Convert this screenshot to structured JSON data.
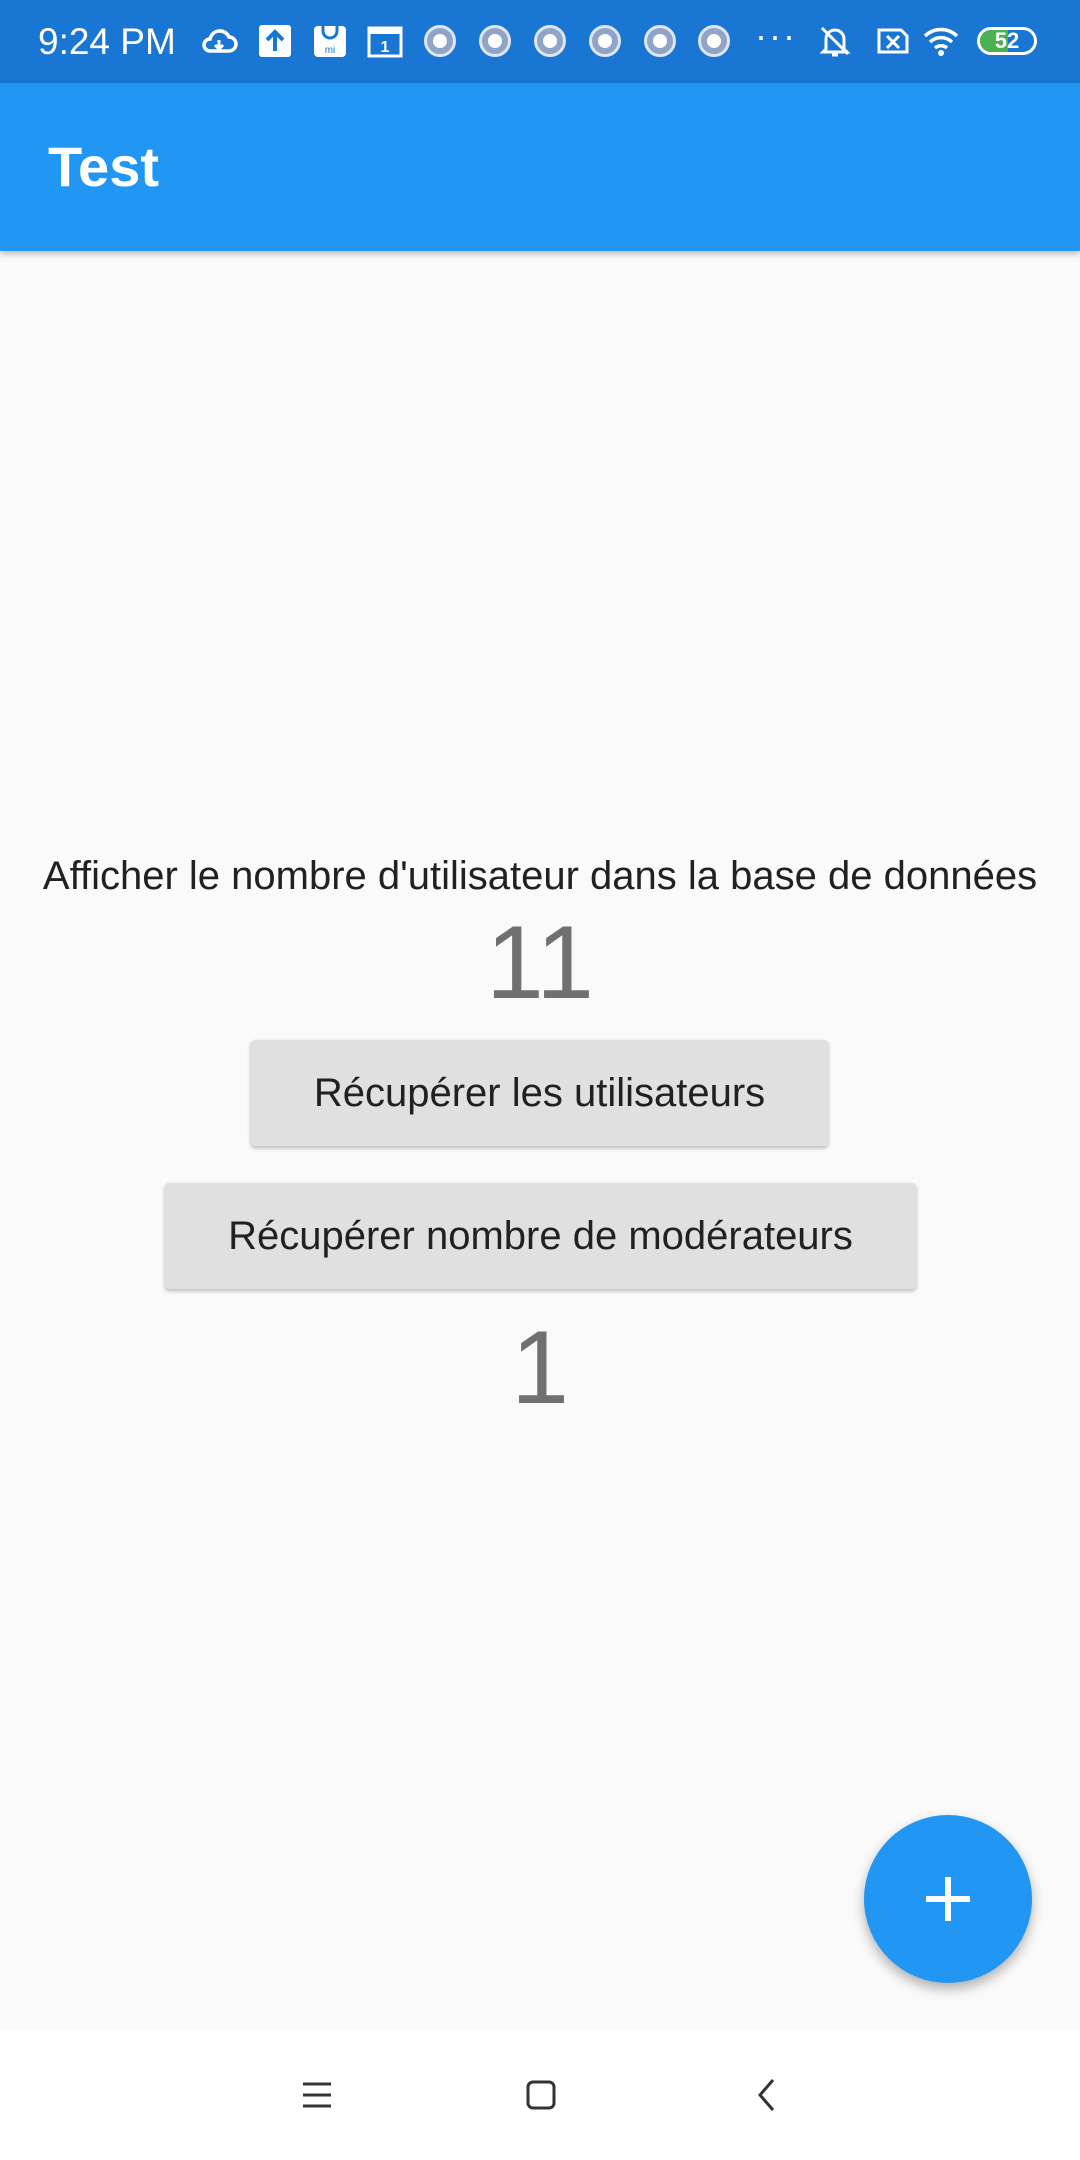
{
  "status_bar": {
    "time": "9:24 PM",
    "battery_level": "52",
    "battery_fraction": 0.52,
    "icons": [
      "cloud-icon",
      "upload-icon",
      "mi-store-icon",
      "calendar-icon",
      "app-notification-icon",
      "app-notification-icon",
      "app-notification-icon",
      "app-notification-icon",
      "app-notification-icon",
      "app-notification-icon",
      "more-icon",
      "bell-off-icon",
      "sim-blocked-icon",
      "wifi-icon",
      "battery-icon"
    ],
    "calendar_day": "1",
    "mi_label": "mi",
    "more": "···"
  },
  "app_bar": {
    "title": "Test"
  },
  "main": {
    "description": "Afficher le nombre d'utilisateur dans la base de données",
    "user_count": "11",
    "fetch_users_label": "Récupérer les utilisateurs",
    "fetch_moderators_label": "Récupérer nombre de modérateurs",
    "moderator_count": "1"
  },
  "fab": {
    "icon": "plus-icon"
  },
  "nav_bar": {
    "icons": [
      "menu-icon",
      "home-icon",
      "back-icon"
    ]
  },
  "colors": {
    "status_bar": "#1976d2",
    "app_bar": "#2196f3",
    "background": "#fafafa",
    "button": "#e0e0e0",
    "fab": "#2196f3",
    "counter_text": "#707070"
  }
}
